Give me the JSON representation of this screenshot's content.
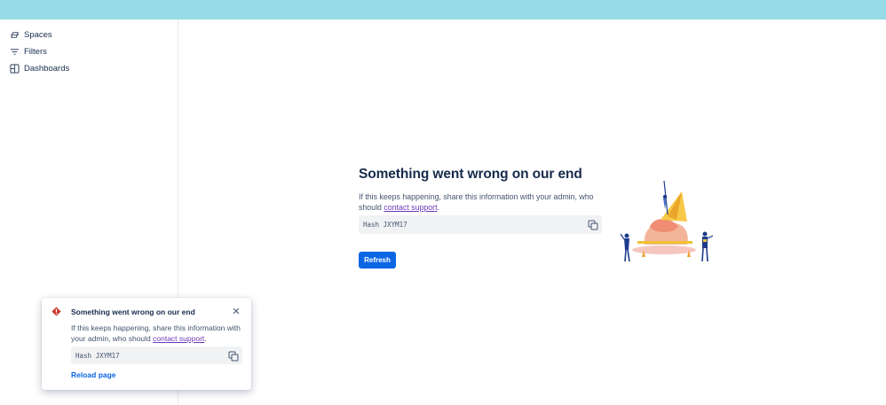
{
  "sidebar": {
    "items": [
      {
        "label": "Spaces",
        "icon": "spaces-icon"
      },
      {
        "label": "Filters",
        "icon": "filter-icon"
      },
      {
        "label": "Dashboards",
        "icon": "dashboard-icon"
      }
    ]
  },
  "error": {
    "title": "Something went wrong on our end",
    "desc_before": "If this keeps happening, share this information with your admin, who should ",
    "link": "contact support",
    "desc_after": ".",
    "hash": "Hash JXYM17",
    "refresh_label": "Refresh"
  },
  "flag": {
    "title": "Something went wrong on our end",
    "desc_before": "If this keeps happening, share this information with your admin, who should ",
    "link": "contact support",
    "desc_after": ".",
    "hash": "Hash JXYM17",
    "reload_label": "Reload page",
    "close_glyph": "✕"
  },
  "colors": {
    "topbar": "#97dbe6",
    "primary": "#0c66e4",
    "link": "#6e3ab8",
    "danger": "#c9372c"
  }
}
